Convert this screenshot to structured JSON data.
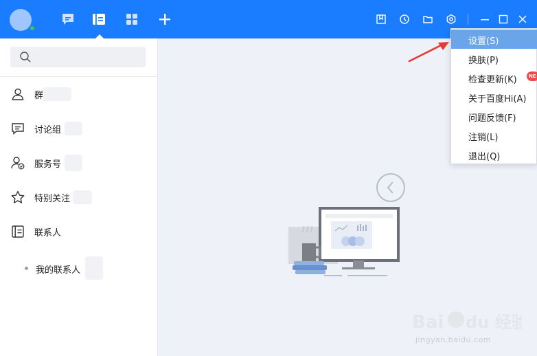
{
  "colors": {
    "topbar": "#1a7cff",
    "menu_active": "#6aa4e9",
    "badge": "#f04b4b",
    "arrow": "#e53935"
  },
  "search": {
    "placeholder": ""
  },
  "contacts": {
    "items": [
      {
        "label": "群",
        "icon": "user-icon"
      },
      {
        "label": "讨论组",
        "icon": "chat-icon"
      },
      {
        "label": "服务号",
        "icon": "user-check-icon"
      },
      {
        "label": "特别关注",
        "icon": "star-icon"
      },
      {
        "label": "联系人",
        "icon": "address-book-icon"
      }
    ],
    "sub_item": "我的联系人"
  },
  "menu": {
    "items": [
      {
        "label": "设置(S)",
        "active": true
      },
      {
        "label": "换肤(P)",
        "active": false
      },
      {
        "label": "检查更新(K)",
        "active": false
      },
      {
        "label": "关于百度Hi(A)",
        "active": false
      },
      {
        "label": "问题反馈(F)",
        "active": false
      },
      {
        "label": "注销(L)",
        "active": false
      },
      {
        "label": "退出(Q)",
        "active": false
      }
    ],
    "badge": "NE"
  },
  "watermark": {
    "line1": "Bai du 经验",
    "line2": "jingyan.baidu.com"
  }
}
